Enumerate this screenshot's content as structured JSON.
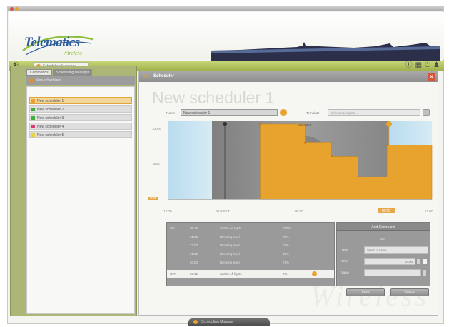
{
  "app": {
    "logo_text": "Telematics",
    "logo_sub": "Wireless"
  },
  "toolbar": {
    "workspace_tab": "Scheduling Manager",
    "icons": [
      "help-icon",
      "grid-icon",
      "power-icon",
      "users-icon"
    ]
  },
  "sidebar": {
    "tabs": [
      "Commands",
      "Scheduling Manager"
    ],
    "header": "New schedulers",
    "items": [
      {
        "label": "New scheduler 1",
        "color": "#e8a32e",
        "selected": true
      },
      {
        "label": "New scheduler 2",
        "color": "#3fae3a",
        "selected": false
      },
      {
        "label": "New scheduler 3",
        "color": "#3fae3a",
        "selected": false
      },
      {
        "label": "New scheduler 4",
        "color": "#d93a7a",
        "selected": false
      },
      {
        "label": "New scheduler 5",
        "color": "#e8d23a",
        "selected": false
      }
    ]
  },
  "scheduler": {
    "panel_title": "Scheduler",
    "title": "New scheduler 1",
    "name_label": "Name",
    "name_value": "New scheduler 1",
    "template_label": "Template",
    "template_value": "Select a template...",
    "chart_label": "SUNSET",
    "y_labels": [
      "100%",
      "60%",
      "OFF"
    ],
    "x_labels": [
      "12:00",
      "SUNSET",
      "00:00",
      "06:00",
      "12:00"
    ]
  },
  "chart_data": {
    "type": "area",
    "x": [
      0.35,
      0.35,
      0.52,
      0.52,
      0.62,
      0.62,
      0.72,
      0.72,
      0.83,
      0.83,
      1.0
    ],
    "y": [
      0,
      100,
      100,
      75,
      75,
      57,
      57,
      30,
      30,
      72,
      72
    ],
    "xlabel": "",
    "ylabel": "",
    "ylim": [
      0,
      100
    ]
  },
  "events_table": {
    "rows": [
      {
        "num": "ON",
        "time": "08:15",
        "cmd": "Switch on lights",
        "level": "100%"
      },
      {
        "num": "",
        "time": "21:30",
        "cmd": "Dimming level",
        "level": "75%"
      },
      {
        "num": "",
        "time": "23:00",
        "cmd": "Dimming level",
        "level": "57%"
      },
      {
        "num": "",
        "time": "01:30",
        "cmd": "Dimming level",
        "level": "30%"
      },
      {
        "num": "",
        "time": "04:00",
        "cmd": "Dimming level",
        "level": "72%"
      },
      {
        "num": "OFF",
        "time": "08:15",
        "cmd": "Switch off lights",
        "level": "0%",
        "selected": true
      }
    ]
  },
  "add_command": {
    "title": "Add Command",
    "subtitle": "Set",
    "type_label": "Type",
    "type_value": "Select a value",
    "time_label": "Time",
    "time_value": "00:00",
    "value_label": "Value",
    "value_value": ""
  },
  "buttons": {
    "save": "Save",
    "cancel": "Cancel"
  },
  "watermark": "Wireless",
  "footer": {
    "tab_label": "Scheduling Manager"
  }
}
